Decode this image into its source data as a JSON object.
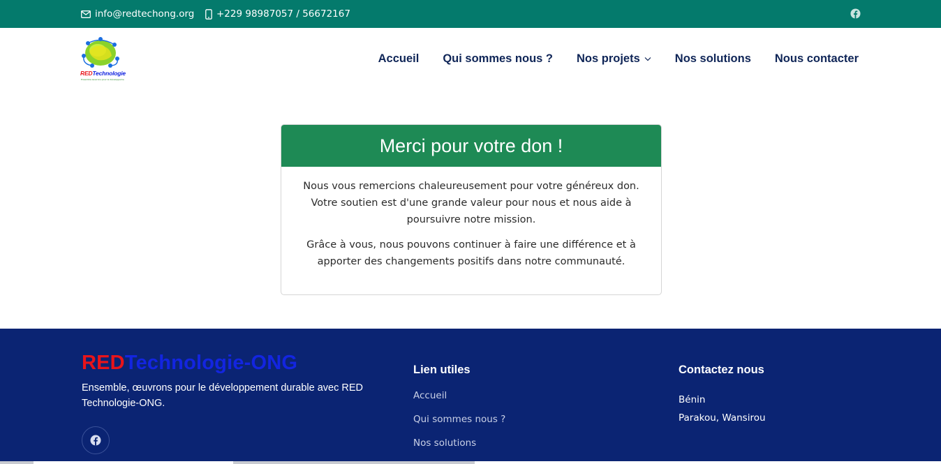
{
  "topbar": {
    "email": "info@redtechong.org",
    "phone": "+229 98987057 / 56672167",
    "social_icon": "facebook-icon",
    "bg_color": "#047a6c"
  },
  "header": {
    "logo_text": "REDTechnologie",
    "logo_subtext": "Ensemble œuvrons pour le développement durable",
    "nav": {
      "home": "Accueil",
      "about": "Qui sommes nous ?",
      "projects": "Nos projets",
      "solutions": "Nos solutions",
      "contact": "Nous contacter"
    },
    "nav_color": "#0f2557"
  },
  "card": {
    "title": "Merci pour votre don !",
    "paragraph1": "Nous vous remercions chaleureusement pour votre généreux don. Votre soutien est d'une grande valeur pour nous et nous aide à poursuivre notre mission.",
    "paragraph2": "Grâce à vous, nous pouvons continuer à faire une différence et à apporter des changements positifs dans notre communauté.",
    "header_color": "#1e8a55"
  },
  "footer": {
    "brand_red": "RED",
    "brand_blue": "Technologie-ONG",
    "tagline": "Ensemble, œuvrons pour le développement durable avec RED Technologie-ONG.",
    "links_title": "Lien utiles",
    "links": [
      "Accueil",
      "Qui sommes nous ?",
      "Nos solutions"
    ],
    "contact_title": "Contactez nous",
    "country": "Bénin",
    "address": "Parakou, Wansirou",
    "bg_color": "#0b2473"
  }
}
